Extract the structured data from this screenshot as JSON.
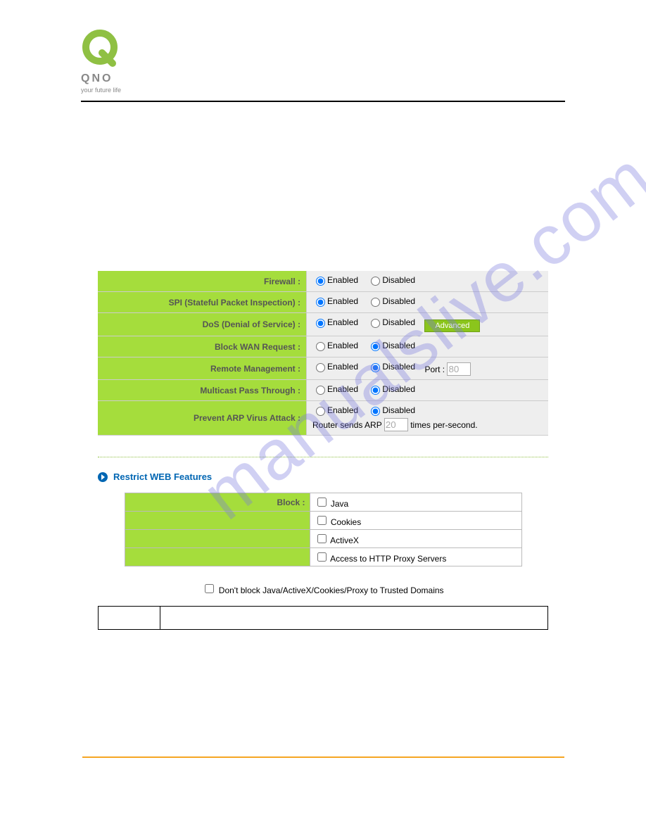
{
  "brand": {
    "name": "QNO",
    "tagline": "your future life"
  },
  "watermark": "manualslive.com",
  "firewall_settings": {
    "rows": [
      {
        "label": "Firewall :",
        "enabled": "Enabled",
        "disabled": "Disabled",
        "selected": "enabled"
      },
      {
        "label": "SPI (Stateful Packet Inspection) :",
        "enabled": "Enabled",
        "disabled": "Disabled",
        "selected": "enabled"
      },
      {
        "label": "DoS (Denial of Service) :",
        "enabled": "Enabled",
        "disabled": "Disabled",
        "selected": "enabled",
        "advanced_btn": "Advanced"
      },
      {
        "label": "Block WAN Request :",
        "enabled": "Enabled",
        "disabled": "Disabled",
        "selected": "disabled"
      },
      {
        "label": "Remote Management :",
        "enabled": "Enabled",
        "disabled": "Disabled",
        "selected": "disabled",
        "port_label": "Port :",
        "port_value": "80"
      },
      {
        "label": "Multicast Pass Through :",
        "enabled": "Enabled",
        "disabled": "Disabled",
        "selected": "disabled"
      },
      {
        "label": "Prevent ARP Virus Attack :",
        "enabled": "Enabled",
        "disabled": "Disabled",
        "selected": "disabled",
        "arp_prefix": "Router sends ARP",
        "arp_value": "20",
        "arp_suffix": "times per-second."
      }
    ]
  },
  "restrict_section": {
    "title": "Restrict WEB Features",
    "block_label": "Block :",
    "items": [
      "Java",
      "Cookies",
      "ActiveX",
      "Access to HTTP Proxy Servers"
    ],
    "trusted_text": "Don't block Java/ActiveX/Cookies/Proxy to Trusted Domains"
  }
}
